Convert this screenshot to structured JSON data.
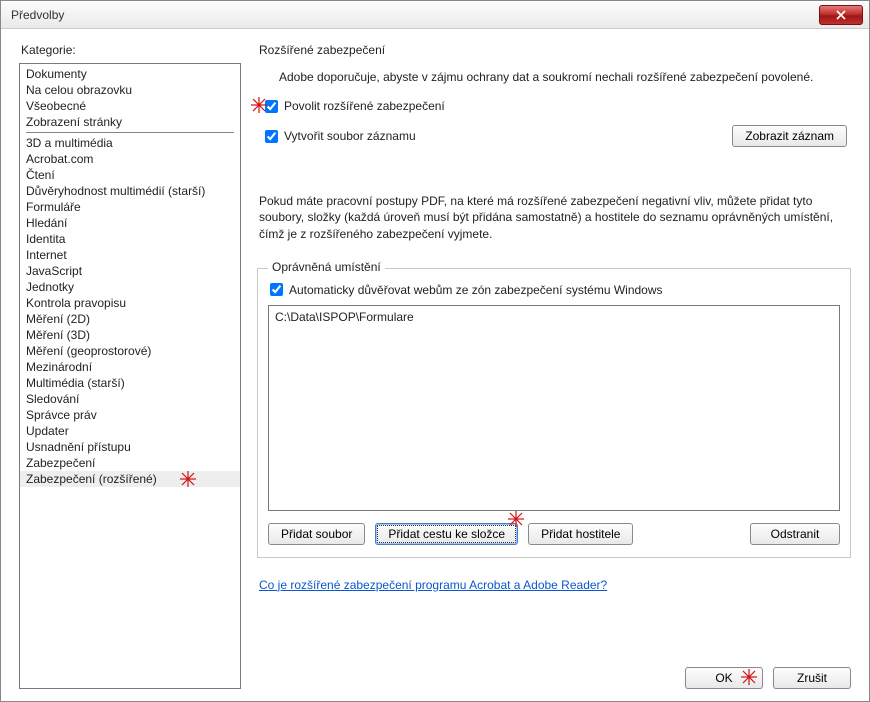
{
  "window": {
    "title": "Předvolby"
  },
  "sidebar": {
    "heading": "Kategorie:",
    "group1": [
      "Dokumenty",
      "Na celou obrazovku",
      "Všeobecné",
      "Zobrazení stránky"
    ],
    "group2": [
      "3D a multimédia",
      "Acrobat.com",
      "Čtení",
      "Důvěryhodnost multimédií (starší)",
      "Formuláře",
      "Hledání",
      "Identita",
      "Internet",
      "JavaScript",
      "Jednotky",
      "Kontrola pravopisu",
      "Měření (2D)",
      "Měření (3D)",
      "Měření (geoprostorové)",
      "Mezinárodní",
      "Multimédia (starší)",
      "Sledování",
      "Správce práv",
      "Updater",
      "Usnadnění přístupu",
      "Zabezpečení",
      "Zabezpečení (rozšířené)"
    ],
    "selected": "Zabezpečení (rozšířené)"
  },
  "panel": {
    "heading": "Rozšířené zabezpečení",
    "intro": "Adobe doporučuje, abyste v zájmu ochrany dat a soukromí nechali rozšířené zabezpečení povolené.",
    "enable_label": "Povolit rozšířené zabezpečení",
    "enable_checked": true,
    "log_label": "Vytvořit soubor záznamu",
    "log_checked": true,
    "show_log_btn": "Zobrazit záznam",
    "whitelist_intro": "Pokud máte pracovní postupy PDF, na které má rozšířené zabezpečení negativní vliv, můžete přidat tyto soubory, složky (každá úroveň musí být přidána samostatně) a hostitele do seznamu oprávněných umístění, čímž je z rozšířeného zabezpečení vyjmete.",
    "fieldset_title": "Oprávněná umístění",
    "trust_zones_label": "Automaticky důvěřovat webům ze zón zabezpečení systému Windows",
    "trust_zones_checked": true,
    "locations": [
      "C:\\Data\\ISPOP\\Formulare"
    ],
    "btn_add_file": "Přidat soubor",
    "btn_add_folder": "Přidat cestu ke složce",
    "btn_add_host": "Přidat hostitele",
    "btn_remove": "Odstranit",
    "help_link": "Co je rozšířené zabezpečení programu Acrobat a Adobe Reader?"
  },
  "footer": {
    "ok": "OK",
    "cancel": "Zrušit"
  }
}
